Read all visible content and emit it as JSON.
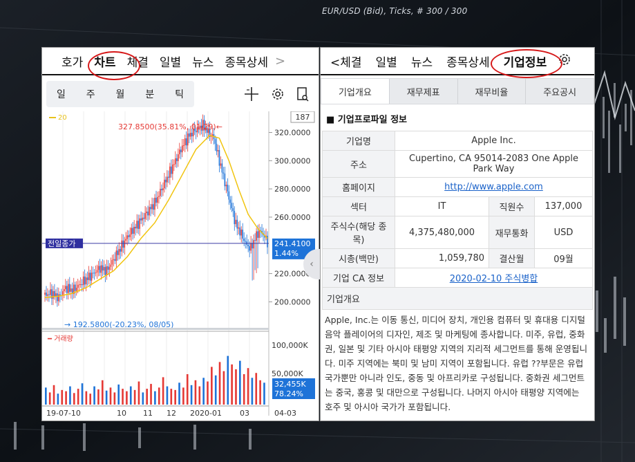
{
  "background": {
    "caption": "EUR/USD (Bid), Ticks, # 300 / 300"
  },
  "left": {
    "tabs": [
      "호가",
      "차트",
      "체결",
      "일별",
      "뉴스",
      "종목상세"
    ],
    "selected": "차트",
    "arrow": ">",
    "periods": [
      "일",
      "주",
      "월",
      "분",
      "틱"
    ],
    "icons": [
      "crosshair-icon",
      "gear-icon",
      "document-search-icon"
    ]
  },
  "right": {
    "tabs": [
      "<체결",
      "일별",
      "뉴스",
      "종목상세",
      "기업정보"
    ],
    "selected": "기업정보",
    "subtabs": [
      "기업개요",
      "재무제표",
      "재무비율",
      "주요공시"
    ],
    "section_title": "■ 기업프로파일 정보",
    "profile": {
      "name_label": "기업명",
      "name": "Apple Inc.",
      "address_label": "주소",
      "address": "Cupertino, CA 95014-2083 One Apple Park Way",
      "homepage_label": "홈페이지",
      "homepage": "http://www.apple.com",
      "sector_label": "섹터",
      "sector": "IT",
      "employees_label": "직원수",
      "employees": "137,000",
      "shares_label": "주식수(해당 종목)",
      "shares": "4,375,480,000",
      "currency_label": "재무통화",
      "currency": "USD",
      "mktcap_label": "시총(백만)",
      "mktcap": "1,059,780",
      "fiscal_label": "결산월",
      "fiscal": "09월",
      "ca_label": "기업 CA 정보",
      "ca": "2020-02-10 주식병합"
    },
    "overview_label": "기업개요",
    "overview": "Apple, Inc.는 이동 통신, 미디어 장치, 개인용 컴퓨터 및 휴대용 디지털 음악 플레이어의 디자인, 제조 및 마케팅에 종사합니다. 미주, 유럽, 중화권, 일본 및 기타 아시아 태평양 지역의 지리적 세그먼트를 통해 운영됩니다. 미주 지역에는 북미 및 남미 지역이 포함됩니다. 유럽 ??부문은 유럽 국가뿐만 아니라 인도, 중동 및 아프리카로 구성됩니다. 중화권 세그먼트는 중국, 홍콩 및 대만으로 구성됩니다. 나머지 아시아 태평양 지역에는 호주 및 아시아 국가가 포함됩니다."
  },
  "chart_data": {
    "type": "line",
    "count_badge": "187",
    "ma_label": "20",
    "y_ticks": [
      "320.0000",
      "300.0000",
      "280.0000",
      "260.0000",
      "220.0000",
      "200.0000"
    ],
    "ylim": [
      185,
      332
    ],
    "x_ticks": [
      "19-07-10",
      "10",
      "11",
      "12",
      "2020-01",
      "03",
      "04-03"
    ],
    "high_label": "327.8500(35.81%, 01/29)←",
    "low_label": "→ 192.5800(-20.23%, 08/05)",
    "prev_close_label": "전일종가",
    "prev_close_value": 241.41,
    "price_badge": [
      "241.4100",
      "1.44%"
    ],
    "volume_label": "━ 거래량",
    "volume_ticks": [
      "100,000K",
      "50,000K"
    ],
    "volume_badge": [
      "32,455K",
      "78.24%"
    ],
    "close_points": [
      [
        0,
        205
      ],
      [
        10,
        206
      ],
      [
        20,
        203
      ],
      [
        30,
        210
      ],
      [
        40,
        208
      ],
      [
        50,
        212
      ],
      [
        60,
        216
      ],
      [
        70,
        220
      ],
      [
        80,
        224
      ],
      [
        90,
        222
      ],
      [
        100,
        230
      ],
      [
        110,
        238
      ],
      [
        120,
        246
      ],
      [
        130,
        252
      ],
      [
        140,
        258
      ],
      [
        150,
        264
      ],
      [
        160,
        270
      ],
      [
        170,
        280
      ],
      [
        180,
        290
      ],
      [
        190,
        300
      ],
      [
        200,
        310
      ],
      [
        210,
        318
      ],
      [
        220,
        322
      ],
      [
        230,
        325
      ],
      [
        238,
        320
      ],
      [
        246,
        316
      ],
      [
        254,
        300
      ],
      [
        262,
        285
      ],
      [
        270,
        270
      ],
      [
        278,
        255
      ],
      [
        286,
        248
      ],
      [
        294,
        240
      ],
      [
        300,
        238
      ],
      [
        306,
        245
      ],
      [
        312,
        250
      ],
      [
        318,
        248
      ],
      [
        324,
        242
      ]
    ],
    "ma_points": [
      [
        0,
        203
      ],
      [
        20,
        204
      ],
      [
        40,
        206
      ],
      [
        60,
        210
      ],
      [
        80,
        216
      ],
      [
        100,
        222
      ],
      [
        120,
        232
      ],
      [
        140,
        245
      ],
      [
        160,
        256
      ],
      [
        180,
        272
      ],
      [
        200,
        290
      ],
      [
        220,
        308
      ],
      [
        240,
        318
      ],
      [
        254,
        316
      ],
      [
        268,
        300
      ],
      [
        282,
        280
      ],
      [
        296,
        262
      ],
      [
        310,
        252
      ],
      [
        324,
        245
      ]
    ],
    "volumes": [
      28,
      20,
      32,
      18,
      24,
      22,
      30,
      19,
      26,
      35,
      22,
      18,
      30,
      25,
      40,
      23,
      28,
      20,
      33,
      26,
      22,
      30,
      24,
      38,
      20,
      26,
      34,
      22,
      28,
      45,
      30,
      26,
      24,
      36,
      28,
      50,
      32,
      40,
      30,
      44,
      38,
      62,
      48,
      70,
      55,
      80,
      66,
      58,
      72,
      50,
      60,
      44,
      52,
      40,
      36
    ]
  }
}
